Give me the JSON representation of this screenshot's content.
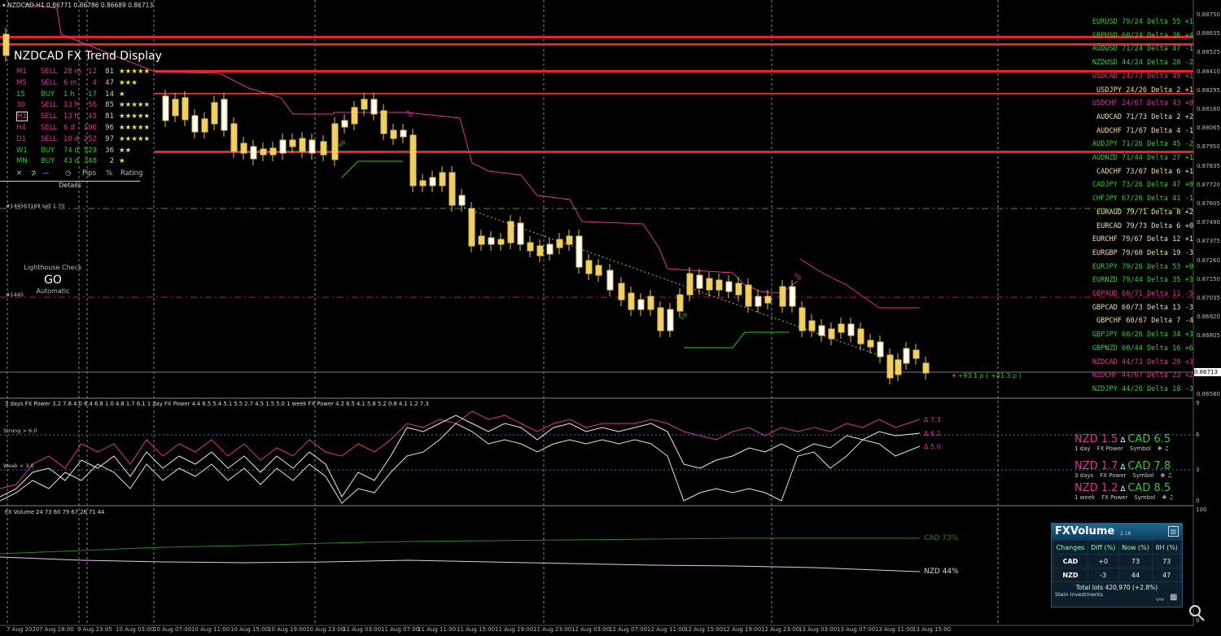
{
  "window": {
    "title": "NZDCAD,H1",
    "ohlc": "0.86771 0.86786 0.86689 0.86713"
  },
  "trend_display": {
    "title": "NZDCAD FX Trend Display",
    "rows": [
      {
        "tf": "M1",
        "dir": "SELL",
        "age": "28 m",
        "pips": "12",
        "pct": "81",
        "rating": "★★★★★",
        "color": "#e0349a"
      },
      {
        "tf": "M5",
        "dir": "SELL",
        "age": "6 m",
        "pips": "4",
        "pct": "47",
        "rating": "★★★",
        "color": "#e0349a"
      },
      {
        "tf": "15",
        "dir": "BUY",
        "age": "1 h",
        "pips": "17",
        "pct": "14",
        "rating": "★",
        "color": "#26d026"
      },
      {
        "tf": "30",
        "dir": "SELL",
        "age": "13 h",
        "pips": "56",
        "pct": "85",
        "rating": "★★★★★",
        "color": "#e0349a"
      },
      {
        "tf": "H1",
        "dir": "SELL",
        "age": "13 h",
        "pips": "45",
        "pct": "81",
        "rating": "★★★★★",
        "color": "#e0349a"
      },
      {
        "tf": "H4",
        "dir": "SELL",
        "age": "6 d",
        "pips": "196",
        "pct": "96",
        "rating": "★★★★★",
        "color": "#e0349a"
      },
      {
        "tf": "D1",
        "dir": "SELL",
        "age": "10 d",
        "pips": "252",
        "pct": "97",
        "rating": "★★★★★",
        "color": "#e0349a"
      },
      {
        "tf": "W1",
        "dir": "BUY",
        "age": "74 d",
        "pips": "529",
        "pct": "36",
        "rating": "★★",
        "color": "#26d026"
      },
      {
        "tf": "MN",
        "dir": "BUY",
        "age": "43 d",
        "pips": "348",
        "pct": "2",
        "rating": "★",
        "color": "#26d026"
      }
    ],
    "footer": {
      "pips": "Pips",
      "pct": "%",
      "rating": "Rating"
    },
    "details_label": "Details"
  },
  "order_labels": {
    "sell_order": "#144563169 sell 1.70",
    "order2": "#1445"
  },
  "lighthouse": {
    "title": "Lighthouse Check",
    "status": "GO",
    "mode": "Automatic"
  },
  "pairs": [
    {
      "text": "EURUSD 79/24 Delta 55  +1",
      "color": "#30d030"
    },
    {
      "text": "GBPUSD 60/24 Delta 36  +4",
      "color": "#30d030"
    },
    {
      "text": "AUDUSD 71/24 Delta 47  -1",
      "color": "#30d030"
    },
    {
      "text": "NZDUSD 44/24 Delta 20  -2",
      "color": "#30d030"
    },
    {
      "text": "USDCAD 24/73 Delta 49  +1",
      "color": "#e0349a"
    },
    {
      "text": "USDJPY 24/26 Delta  2  +1",
      "color": "#f5deb3"
    },
    {
      "text": "USDCHF 24/67 Delta 43  +0",
      "color": "#e0349a"
    },
    {
      "text": "AUDCAD 71/73 Delta  2  +2",
      "color": "#f5deb3"
    },
    {
      "text": "AUDCHF 71/67 Delta  4  -1",
      "color": "#f5deb3"
    },
    {
      "text": "AUDJPY 71/26 Delta 45  -2",
      "color": "#30d030"
    },
    {
      "text": "AUDNZD 71/44 Delta 27  +1",
      "color": "#30d030"
    },
    {
      "text": "CADCHF 73/67 Delta  6  +1",
      "color": "#f5deb3"
    },
    {
      "text": "CADJPY 73/26 Delta 47  +0",
      "color": "#30d030"
    },
    {
      "text": "CHFJPY 67/26 Delta 41  -1",
      "color": "#30d030"
    },
    {
      "text": "EURAUD 79/71 Delta  8  +2",
      "color": "#f5deb3"
    },
    {
      "text": "EURCAD 79/73 Delta  6  +0",
      "color": "#f5deb3"
    },
    {
      "text": "EURCHF 79/67 Delta 12  +1",
      "color": "#f5deb3"
    },
    {
      "text": "EURGBP 79/60 Delta 19  -3",
      "color": "#f5deb3"
    },
    {
      "text": "EURJPY 79/26 Delta 53  +0",
      "color": "#30d030"
    },
    {
      "text": "EURNZD 79/44 Delta 35  +3",
      "color": "#30d030"
    },
    {
      "text": "GBPAUD 60/71 Delta 11  -5",
      "color": "#e0349a"
    },
    {
      "text": "GBPCAD 60/73 Delta 13  -3",
      "color": "#f5deb3"
    },
    {
      "text": "GBPCHF 60/67 Delta  7  -4",
      "color": "#f5deb3"
    },
    {
      "text": "GBPJPY 60/26 Delta 34  +3",
      "color": "#30d030"
    },
    {
      "text": "GBPNZD 60/44 Delta 16  +6",
      "color": "#30d030"
    },
    {
      "text": "NZDCAD 44/73 Delta 29  +3",
      "color": "#e0349a"
    },
    {
      "text": "NZDCHF 44/67 Delta 23  +2",
      "color": "#e0349a"
    },
    {
      "text": "NZDJPY 44/26 Delta 18  -3",
      "color": "#30d030"
    }
  ],
  "price_axis": [
    "0.88750",
    "0.88635",
    "0.88525",
    "0.88410",
    "0.88295",
    "0.88180",
    "0.88065",
    "0.87950",
    "0.87835",
    "0.87720",
    "0.87605",
    "0.87490",
    "0.87375",
    "0.87260",
    "0.87150",
    "0.87035",
    "0.86920",
    "0.86805",
    "0.86713",
    "0.86580"
  ],
  "current_price": "0.86713",
  "profit_label": "+93.1 p ( +41.3 p )",
  "power_panel": {
    "header": "3 days FX Power 3.2 7.8 4.0 6.4 6.8 1.0 4.8 1.7 6.1    1 day FX Power 4.4 6.5 5.4 5.1 5.5 2.7 4.5 1.5 5.0    1 week FX Power 4.2 8.5 4.1 5.8 5.2 0.8 4.1 1.2 7.3",
    "strong_label": "Strong > 6.0",
    "weak_label": "Weak < 3.0",
    "deltas": [
      "Δ 7.3",
      "Δ 6.1",
      "Δ 5.0"
    ],
    "axis": [
      "9",
      "6",
      "3",
      "0"
    ],
    "blocks": [
      {
        "nzd": "NZD 1.5",
        "cad": "CAD 6.5",
        "period": "1 day",
        "power": "FX Power",
        "symbol": "Symbol"
      },
      {
        "nzd": "NZD 1.7",
        "cad": "CAD 7.8",
        "period": "3 days",
        "power": "FX Power",
        "symbol": "Symbol"
      },
      {
        "nzd": "NZD 1.2",
        "cad": "CAD 8.5",
        "period": "1 week",
        "power": "FX Power",
        "symbol": "Symbol"
      }
    ]
  },
  "volume_panel": {
    "header": "FX Volume 24 73 60 79 67 26 71 44",
    "cad_label": "CAD 73%",
    "nzd_label": "NZD 44%",
    "axis_top": "100",
    "axis_bottom": "0",
    "widget": {
      "brand": "FXVolume",
      "version": "2.16",
      "headers": [
        "Changes",
        "Diff (%)",
        "Now (%)",
        "8H (%)"
      ],
      "rows": [
        [
          "CAD",
          "+0",
          "73",
          "73"
        ],
        [
          "NZD",
          "-3",
          "44",
          "47"
        ]
      ],
      "total": "Total lots 420,970 (+2.8%)",
      "vendor": "Stein Investments"
    }
  },
  "time_axis": [
    "7 Aug 2020",
    "7 Aug 18:00",
    "9 Aug 23:05",
    "10 Aug 03:00",
    "10 Aug 07:00",
    "10 Aug 11:00",
    "10 Aug 15:00",
    "10 Aug 19:00",
    "10 Aug 23:00",
    "11 Aug 03:00",
    "11 Aug 07:00",
    "11 Aug 11:00",
    "11 Aug 15:00",
    "11 Aug 19:00",
    "11 Aug 23:00",
    "12 Aug 03:00",
    "12 Aug 07:00",
    "12 Aug 11:00",
    "12 Aug 15:00",
    "12 Aug 19:00",
    "12 Aug 23:00",
    "13 Aug 03:00",
    "13 Aug 07:00",
    "13 Aug 11:00",
    "13 Aug 15:00"
  ],
  "colors": {
    "up": "#ffffff",
    "down": "#f2d060",
    "sell": "#e0349a",
    "buy": "#26d026",
    "level": "#e02626"
  }
}
